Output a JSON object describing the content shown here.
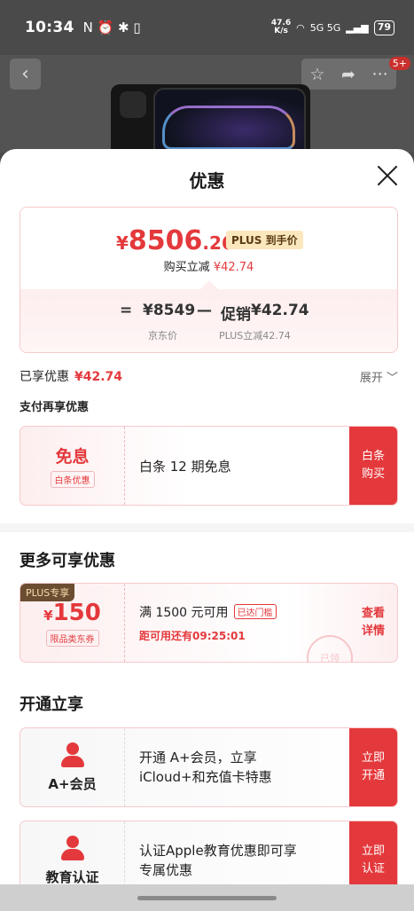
{
  "status_bar": {
    "time": "10:34",
    "icons_left": "N ⏰ ✱ ▯",
    "speed_top": "47.6",
    "speed_bottom": "K/s",
    "signal": "5G 5G",
    "battery": "79"
  },
  "header": {
    "back_icon": "back-icon",
    "star_icon": "star-icon",
    "share_icon": "share-icon",
    "more_icon": "more-icon",
    "badge": "5+"
  },
  "sheet": {
    "title": "优惠"
  },
  "price_card": {
    "currency": "¥",
    "price_int": "8506",
    "price_dec": ".26",
    "plus_tag": "PLUS 到手价",
    "reduce_label": "购买立减",
    "reduce_value": "¥42.74",
    "eq": "=",
    "jd_price": "¥8549",
    "minus": "—",
    "promo_label": "促销",
    "promo_value": "¥42.74",
    "jd_price_label": "京东价",
    "plus_reduce_label": "PLUS立减42.74"
  },
  "enjoyed": {
    "label": "已享优惠",
    "value": "¥42.74",
    "expand": "展开 ﹀"
  },
  "pay_more": "支付再享优惠",
  "baitiao": {
    "title": "免息",
    "tag": "白条优惠",
    "desc": "白条 12 期免息",
    "btn_line1": "白条",
    "btn_line2": "购买"
  },
  "more_section": {
    "title": "更多可享优惠"
  },
  "coupon_150": {
    "plus_only": "PLUS专享",
    "currency": "¥",
    "amount": "150",
    "tag": "限品类东券",
    "condition": "满 1500 元可用",
    "reached": "已达门槛",
    "countdown": "距可用还有09:25:01",
    "btn_line1": "查看",
    "btn_line2": "详情",
    "stamp": "已领"
  },
  "open_section": {
    "title": "开通立享"
  },
  "aplus": {
    "label": "A+会员",
    "line1": "开通 A+会员，立享",
    "line2": "iCloud+和充值卡特惠",
    "btn_line1": "立即",
    "btn_line2": "开通"
  },
  "edu": {
    "label": "教育认证",
    "line1": "认证Apple教育优惠即可享",
    "line2": "专属优惠",
    "btn_line1": "立即",
    "btn_line2": "认证"
  }
}
